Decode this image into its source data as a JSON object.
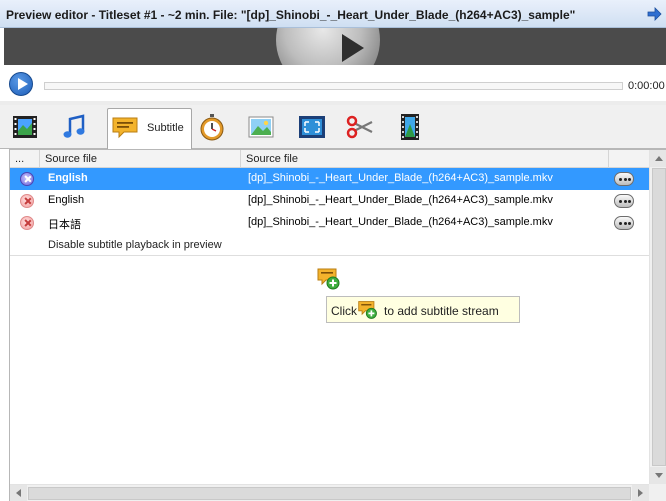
{
  "window": {
    "title": "Preview editor - Titleset #1 - ~2 min. File: \"[dp]_Shinobi_-_Heart_Under_Blade_(h264+AC3)_sample\"",
    "pin_icon": "pin-arrow-icon"
  },
  "player": {
    "time": "0:00:00",
    "play_icon": "play-icon",
    "progress_fraction": 0
  },
  "tabs": [
    {
      "name": "video",
      "icon": "film-strip-icon"
    },
    {
      "name": "audio",
      "icon": "music-note-icon"
    },
    {
      "name": "subtitle",
      "icon": "subtitle-bubble-icon",
      "label": "Subtitle",
      "active": true
    },
    {
      "name": "chapters",
      "icon": "stopwatch-icon"
    },
    {
      "name": "background",
      "icon": "picture-icon"
    },
    {
      "name": "crop",
      "icon": "crop-frame-icon"
    },
    {
      "name": "cut",
      "icon": "scissors-icon"
    },
    {
      "name": "transcode",
      "icon": "film-settings-icon"
    }
  ],
  "grid": {
    "columns": [
      "...",
      "Source file",
      "Source file"
    ],
    "rows": [
      {
        "language": "English",
        "file": "[dp]_Shinobi_-_Heart_Under_Blade_(h264+AC3)_sample.mkv",
        "selected": true
      },
      {
        "language": "English",
        "file": "[dp]_Shinobi_-_Heart_Under_Blade_(h264+AC3)_sample.mkv",
        "selected": false
      },
      {
        "language": "日本語",
        "file": "[dp]_Shinobi_-_Heart_Under_Blade_(h264+AC3)_sample.mkv",
        "selected": false
      }
    ],
    "disable_label": "Disable subtitle playback in preview"
  },
  "hint": {
    "prefix": "Click",
    "suffix": "to add subtitle stream",
    "icon": "add-subtitle-icon"
  },
  "colors": {
    "selection": "#3399ff",
    "titlebar": "#cfdff2",
    "hint_bg": "#ffffe1"
  }
}
